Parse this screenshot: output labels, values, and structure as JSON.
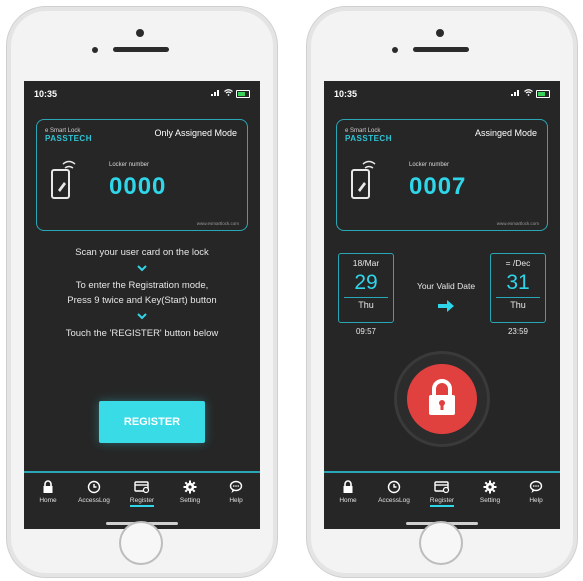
{
  "colors": {
    "accent": "#2fd6ea",
    "screen_bg": "#262626",
    "border": "#2aa7b6",
    "lock_red": "#e0413f"
  },
  "left_screen": {
    "status": {
      "time": "10:35"
    },
    "card": {
      "brand_top": "e Smart Lock",
      "brand_main": "PASSTECH",
      "mode": "Only Assigned Mode",
      "locker_label": "Locker number",
      "locker_number": "0000",
      "site": "www.esmartlock.com"
    },
    "instructions": {
      "step1": "Scan your user card on the lock",
      "step2_line1": "To enter the Registration mode,",
      "step2_line2": "Press 9 twice and Key(Start) button",
      "step3": "Touch the 'REGISTER' button below"
    },
    "register_button": "REGISTER"
  },
  "right_screen": {
    "status": {
      "time": "10:35"
    },
    "card": {
      "brand_top": "e Smart Lock",
      "brand_main": "PASSTECH",
      "mode": "Assinged Mode",
      "locker_label": "Locker number",
      "locker_number": "0007",
      "site": "www.esmartlock.com"
    },
    "valid": {
      "label": "Your Valid Date",
      "start": {
        "month": "18/Mar",
        "day": "29",
        "weekday": "Thu",
        "time": "09:57"
      },
      "end": {
        "month": "= /Dec",
        "day": "31",
        "weekday": "Thu",
        "time": "23:59"
      }
    }
  },
  "tabs": [
    {
      "label": "Home",
      "icon": "lock-icon"
    },
    {
      "label": "AccessLog",
      "icon": "clock-icon"
    },
    {
      "label": "Register",
      "icon": "card-register-icon"
    },
    {
      "label": "Setting",
      "icon": "gear-icon"
    },
    {
      "label": "Help",
      "icon": "chat-bubble-icon"
    }
  ]
}
